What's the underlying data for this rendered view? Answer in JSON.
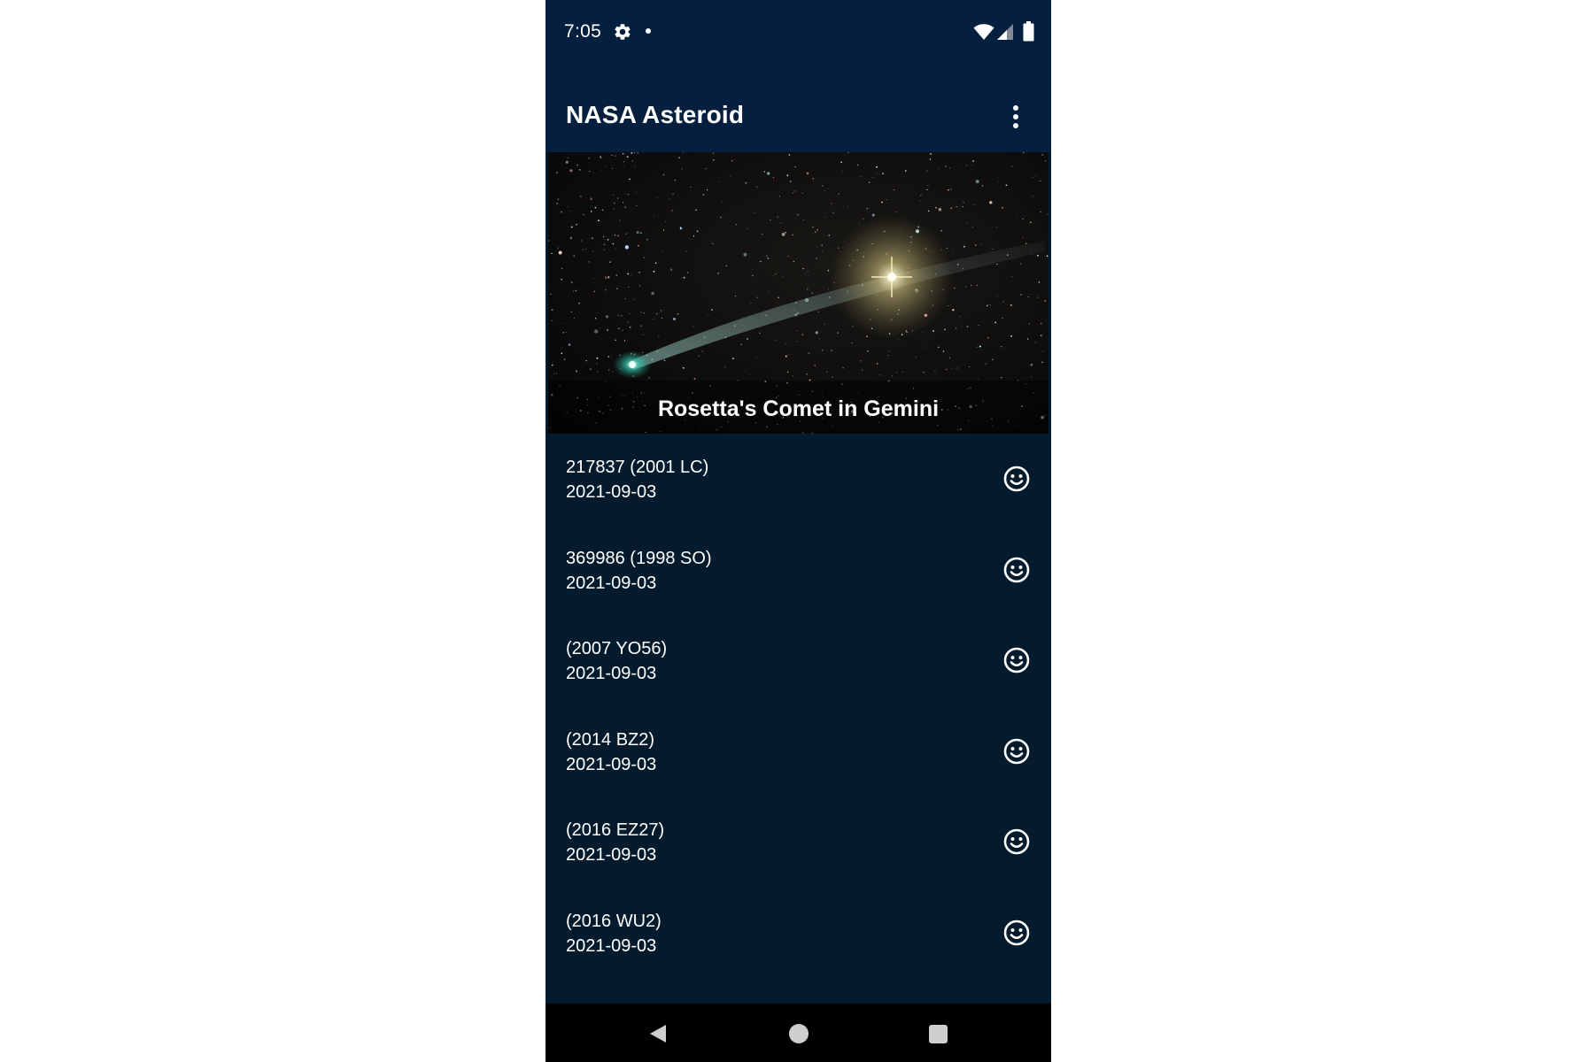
{
  "status_bar": {
    "time": "7:05",
    "icons": [
      "gear-icon",
      "notification-dot-icon",
      "wifi-icon",
      "cell-signal-icon",
      "battery-icon"
    ]
  },
  "app_bar": {
    "title": "NASA Asteroid",
    "menu_icon": "more-vert-icon"
  },
  "picture_of_day": {
    "caption": "Rosetta's Comet in Gemini"
  },
  "asteroids": [
    {
      "name": "217837 (2001 LC)",
      "date": "2021-09-03",
      "status_icon": "smiley-icon"
    },
    {
      "name": "369986 (1998 SO)",
      "date": "2021-09-03",
      "status_icon": "smiley-icon"
    },
    {
      "name": "(2007 YO56)",
      "date": "2021-09-03",
      "status_icon": "smiley-icon"
    },
    {
      "name": "(2014 BZ2)",
      "date": "2021-09-03",
      "status_icon": "smiley-icon"
    },
    {
      "name": "(2016 EZ27)",
      "date": "2021-09-03",
      "status_icon": "smiley-icon"
    },
    {
      "name": "(2016 WU2)",
      "date": "2021-09-03",
      "status_icon": "smiley-icon"
    }
  ],
  "nav_bar": {
    "icons": [
      "back-icon",
      "home-icon",
      "recents-icon"
    ]
  },
  "colors": {
    "app_bar": "#05203f",
    "background": "#041b2d",
    "nav_bar": "#000000",
    "text": "#ffffff"
  }
}
